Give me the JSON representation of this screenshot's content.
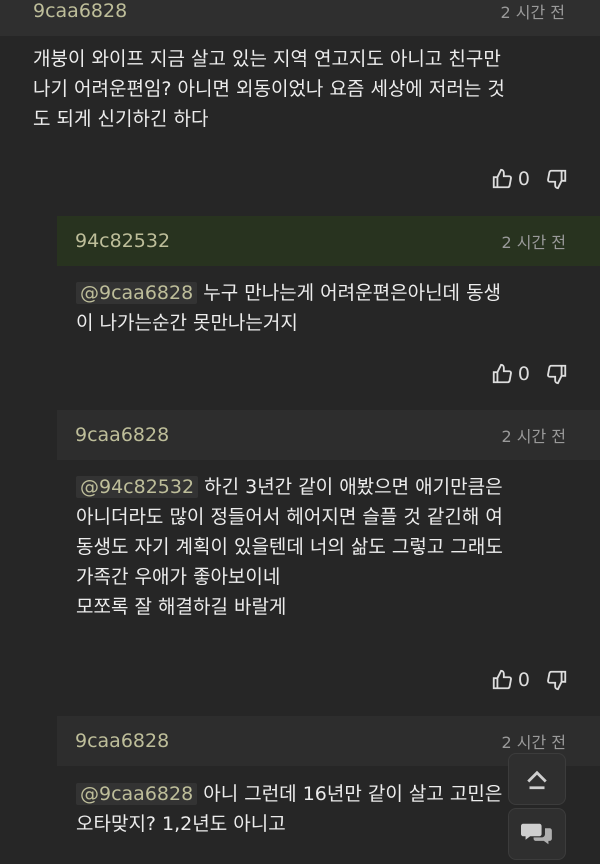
{
  "comments": [
    {
      "nickname": "9caa6828",
      "time": "2 시간 전",
      "text": "개붕이 와이프 지금 살고 있는 지역 연고지도 아니고 친구만\n나기 어려운편임? 아니면 외동이었나 요즘 세상에 저러는 것\n도 되게 신기하긴 하다",
      "likes": "0"
    },
    {
      "nickname": "94c82532",
      "time": "2 시간 전",
      "mention": "@9caa6828",
      "text": " 누구 만나는게 어려운편은아닌데 동생\n이 나가는순간 못만나는거지",
      "likes": "0"
    },
    {
      "nickname": "9caa6828",
      "time": "2 시간 전",
      "mention": "@94c82532",
      "text": " 하긴 3년간 같이 애봤으면 애기만큼은\n아니더라도 많이 정들어서 헤어지면 슬플 것 같긴해 여\n동생도 자기 계획이 있을텐데 너의 삶도 그렇고 그래도\n가족간 우애가 좋아보이네\n모쪼록 잘 해결하길 바랄게",
      "likes": "0"
    },
    {
      "nickname": "9caa6828",
      "time": "2 시간 전",
      "mention": "@9caa6828",
      "text": " 아니 그런데 16년만 같이 살고 고민은\n오타맞지? 1,2년도 아니고"
    }
  ],
  "icons": {
    "like": "thumbs-up-icon",
    "dislike": "thumbs-down-icon",
    "scroll_top": "chevron-up-icon",
    "chat": "chat-bubbles-icon"
  },
  "colors": {
    "background": "#262626",
    "nickname": "#bebe9a",
    "highlight_header": "#28331f"
  }
}
